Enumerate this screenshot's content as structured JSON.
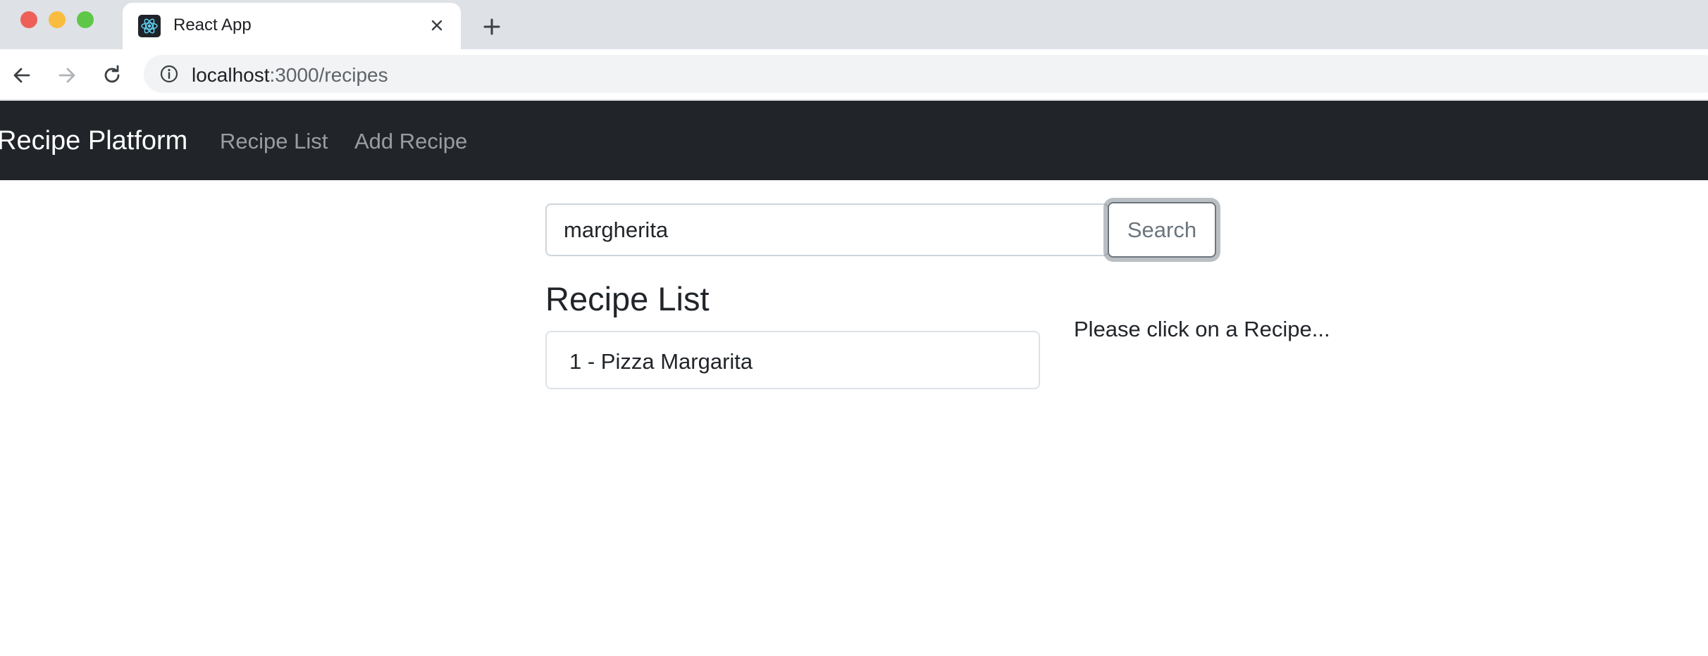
{
  "browser": {
    "tab_title": "React App",
    "url_host": "localhost",
    "url_path": ":3000/recipes",
    "icons": {
      "favicon": "react-logo-icon",
      "close": "close-icon",
      "new_tab": "plus-icon",
      "back": "arrow-left-icon",
      "forward": "arrow-right-icon",
      "reload": "reload-icon",
      "site_info": "info-icon"
    }
  },
  "navbar": {
    "brand": "Recipe Platform",
    "links": [
      "Recipe List",
      "Add Recipe"
    ],
    "background": "#212529"
  },
  "search": {
    "value": "margherita",
    "button_label": "Search"
  },
  "recipe_list": {
    "heading": "Recipe List",
    "items": [
      "1 - Pizza Margarita"
    ]
  },
  "detail": {
    "placeholder": "Please click on a Recipe..."
  }
}
